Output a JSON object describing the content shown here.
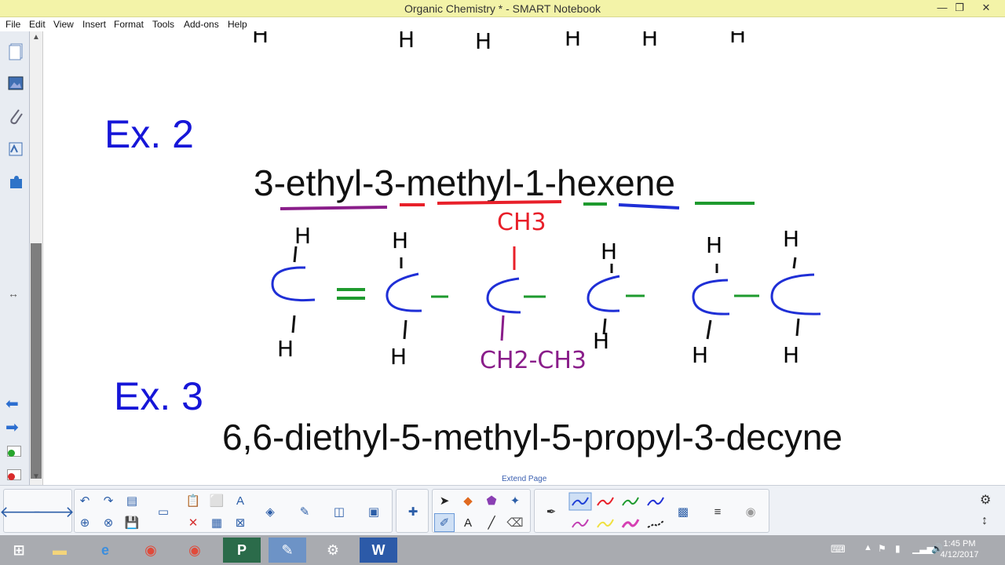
{
  "window": {
    "title": "Organic Chemistry * - SMART Notebook"
  },
  "menu": [
    "File",
    "Edit",
    "View",
    "Insert",
    "Format",
    "Tools",
    "Add-ons",
    "Help"
  ],
  "page": {
    "ex2_label": "Ex. 2",
    "ex2_name": "3-ethyl-3-methyl-1-hexene",
    "ex3_label": "Ex. 3",
    "ex3_name": "6,6-diethyl-5-methyl-5-propyl-3-decyne",
    "extend_page": "Extend Page"
  },
  "drawing": {
    "h": "H",
    "c": "C",
    "eq": "=",
    "dash": "-",
    "ch3": "CH3",
    "ch2_ch3": "CH2-CH3",
    "colors": {
      "black": "#000000",
      "red": "#e8202a",
      "green": "#1e9a2e",
      "blue": "#1f2fd6",
      "purple": "#8a1e8a"
    }
  },
  "clock": {
    "time": "1:45 PM",
    "date": "4/12/2017"
  },
  "colors": {
    "titlebar": "#f3f3a8",
    "ex_blue": "#1616d8"
  }
}
